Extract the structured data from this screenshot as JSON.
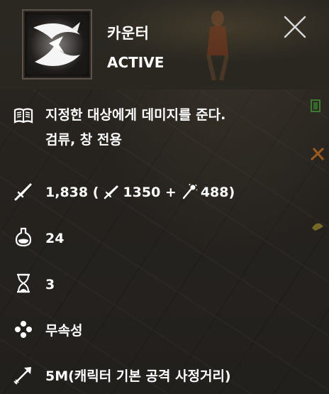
{
  "skill": {
    "name": "카운터",
    "type": "ACTIVE"
  },
  "close_icon": "close-icon",
  "description": {
    "icon": "book-icon",
    "line1": "지정한 대상에게 데미지를 준다.",
    "line2": "검류, 창 전용"
  },
  "damage": {
    "icon": "sword-icon",
    "total": "1,838 (",
    "physical_icon": "blade-icon",
    "physical": "1350 +",
    "magic_icon": "magic-wand-icon",
    "magic": "488)"
  },
  "mana": {
    "icon": "potion-icon",
    "value": "24"
  },
  "cooldown": {
    "icon": "hourglass-icon",
    "value": "3"
  },
  "element": {
    "icon": "dots-icon",
    "value": "무속성"
  },
  "range": {
    "icon": "arrow-icon",
    "value": "5M(캐릭터 기본 공격 사정거리)"
  },
  "colors": {
    "text": "#ffffff",
    "header_bg": "#2b2822",
    "body_bg": "#262320",
    "frame_border": "#5d5249"
  }
}
